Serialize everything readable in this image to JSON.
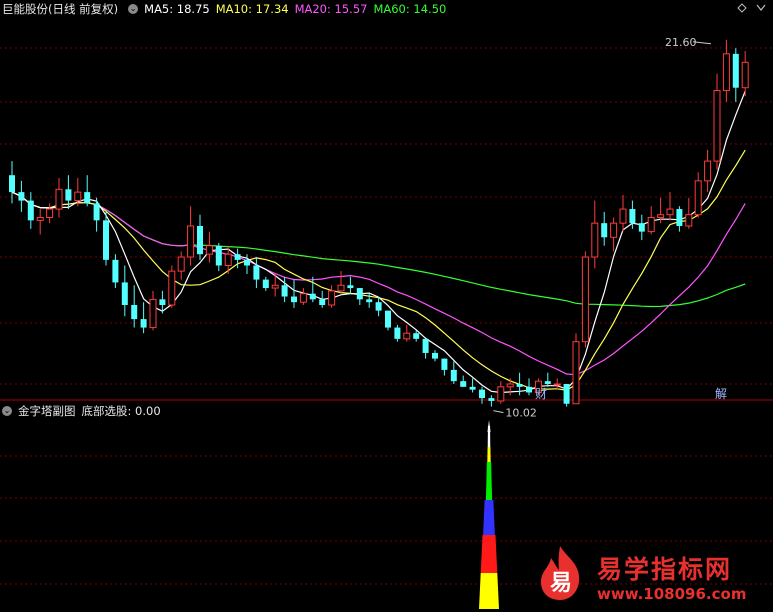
{
  "header_main": {
    "stock": "巨能股份(日线 前复权)",
    "ma5": "MA5: 18.75",
    "ma10": "MA10: 17.34",
    "ma20": "MA20: 15.57",
    "ma60": "MA60: 14.50"
  },
  "header_sub": {
    "indicator": "金字塔副图",
    "value": "底部选股: 0.00"
  },
  "annotations": {
    "high": "21.60",
    "low": "10.02",
    "marker1": "财",
    "marker2": "解"
  },
  "colors": {
    "up": "#ff3b3b",
    "down": "#54ffff",
    "ma5": "#ffffff",
    "ma10": "#ffff55",
    "ma20": "#ff55ff",
    "ma60": "#33ff33"
  },
  "logo": {
    "char": "易",
    "name": "易学指标网",
    "url": "www.108096.com"
  },
  "chart_data": {
    "type": "candlestick",
    "price_range": [
      9.4,
      22.3
    ],
    "candles": [
      [
        16.8,
        17.3,
        15.8,
        16.2
      ],
      [
        16.2,
        16.6,
        15.5,
        15.9
      ],
      [
        15.9,
        16.2,
        14.9,
        15.2
      ],
      [
        15.2,
        15.6,
        14.7,
        15.3
      ],
      [
        15.3,
        15.8,
        15.1,
        15.6
      ],
      [
        15.6,
        16.7,
        15.3,
        16.3
      ],
      [
        16.3,
        16.8,
        15.6,
        15.9
      ],
      [
        15.9,
        16.7,
        15.7,
        16.2
      ],
      [
        16.2,
        16.8,
        15.7,
        15.8
      ],
      [
        15.8,
        16.0,
        14.8,
        15.2
      ],
      [
        15.2,
        15.5,
        13.6,
        13.8
      ],
      [
        13.8,
        14.0,
        12.8,
        13.0
      ],
      [
        13.0,
        13.6,
        11.8,
        12.2
      ],
      [
        12.2,
        12.9,
        11.4,
        11.7
      ],
      [
        11.7,
        12.3,
        11.2,
        11.4
      ],
      [
        11.4,
        12.7,
        11.3,
        12.4
      ],
      [
        12.4,
        12.7,
        11.9,
        12.2
      ],
      [
        12.2,
        13.6,
        12.1,
        13.4
      ],
      [
        13.4,
        14.1,
        13.1,
        13.9
      ],
      [
        13.9,
        15.7,
        13.6,
        15.0
      ],
      [
        15.0,
        15.4,
        13.8,
        14.0
      ],
      [
        14.0,
        14.8,
        13.7,
        14.3
      ],
      [
        14.3,
        14.4,
        13.4,
        13.6
      ],
      [
        13.6,
        14.3,
        13.3,
        14.0
      ],
      [
        14.0,
        14.2,
        13.5,
        13.8
      ],
      [
        13.8,
        14.0,
        13.3,
        13.6
      ],
      [
        13.6,
        13.9,
        12.8,
        13.1
      ],
      [
        13.1,
        13.2,
        12.7,
        12.8
      ],
      [
        12.8,
        13.3,
        12.5,
        12.9
      ],
      [
        12.9,
        13.2,
        12.3,
        12.5
      ],
      [
        12.5,
        13.1,
        12.1,
        12.3
      ],
      [
        12.3,
        12.8,
        12.2,
        12.6
      ],
      [
        12.6,
        13.2,
        12.3,
        12.4
      ],
      [
        12.4,
        12.7,
        12.1,
        12.2
      ],
      [
        12.2,
        12.9,
        12.1,
        12.7
      ],
      [
        12.7,
        13.4,
        12.6,
        12.9
      ],
      [
        12.9,
        13.2,
        12.6,
        12.8
      ],
      [
        12.8,
        12.8,
        12.2,
        12.4
      ],
      [
        12.4,
        12.6,
        12.1,
        12.3
      ],
      [
        12.3,
        12.5,
        11.8,
        12.0
      ],
      [
        12.0,
        12.0,
        11.3,
        11.4
      ],
      [
        11.4,
        11.5,
        10.9,
        11.0
      ],
      [
        11.0,
        11.5,
        10.9,
        11.2
      ],
      [
        11.2,
        11.3,
        10.9,
        11.0
      ],
      [
        11.0,
        11.0,
        10.3,
        10.5
      ],
      [
        10.5,
        10.6,
        10.2,
        10.3
      ],
      [
        10.3,
        10.3,
        9.7,
        9.9
      ],
      [
        9.9,
        10.2,
        9.4,
        9.5
      ],
      [
        9.5,
        9.7,
        9.3,
        9.3
      ],
      [
        9.3,
        9.6,
        9.1,
        9.2
      ],
      [
        9.2,
        9.3,
        8.7,
        8.9
      ],
      [
        8.9,
        9.0,
        8.6,
        8.8
      ],
      [
        8.8,
        9.5,
        8.7,
        9.3
      ],
      [
        9.3,
        9.6,
        9.0,
        9.4
      ],
      [
        9.4,
        9.8,
        9.0,
        9.3
      ],
      [
        9.3,
        9.6,
        9.0,
        9.1
      ],
      [
        9.1,
        9.6,
        9.0,
        9.5
      ],
      [
        9.5,
        9.8,
        9.3,
        9.4
      ],
      [
        9.4,
        9.6,
        9.2,
        9.4
      ],
      [
        9.4,
        9.4,
        8.6,
        8.7
      ],
      [
        8.7,
        11.2,
        8.7,
        10.9
      ],
      [
        10.9,
        14.1,
        10.7,
        13.9
      ],
      [
        13.9,
        15.9,
        13.5,
        15.1
      ],
      [
        15.1,
        15.5,
        14.3,
        14.6
      ],
      [
        14.6,
        15.3,
        14.1,
        15.1
      ],
      [
        15.1,
        16.1,
        14.8,
        15.6
      ],
      [
        15.6,
        15.9,
        14.9,
        15.1
      ],
      [
        15.1,
        15.4,
        14.5,
        14.8
      ],
      [
        14.8,
        15.7,
        14.7,
        15.3
      ],
      [
        15.3,
        16.0,
        15.1,
        15.4
      ],
      [
        15.4,
        16.2,
        15.2,
        15.6
      ],
      [
        15.6,
        15.7,
        14.8,
        15.0
      ],
      [
        15.0,
        16.0,
        14.9,
        15.4
      ],
      [
        15.4,
        16.9,
        15.3,
        16.6
      ],
      [
        16.6,
        17.7,
        16.2,
        17.3
      ],
      [
        17.3,
        20.4,
        17.0,
        19.8
      ],
      [
        19.8,
        21.6,
        19.4,
        21.1
      ],
      [
        21.1,
        21.3,
        19.4,
        19.9
      ],
      [
        19.9,
        21.2,
        19.6,
        20.8
      ]
    ]
  }
}
